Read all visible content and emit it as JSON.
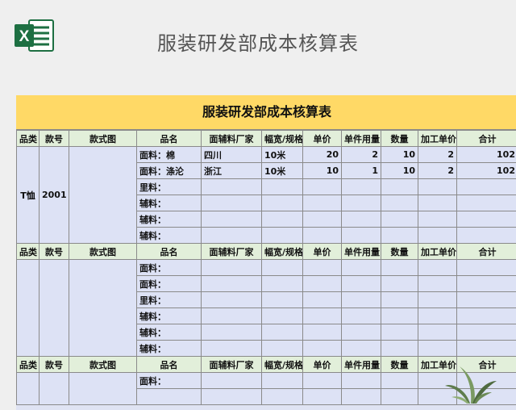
{
  "header": {
    "page_title": "服装研发部成本核算表",
    "logo_letter": "X"
  },
  "sheet": {
    "title": "服装研发部成本核算表",
    "columns": [
      "品类",
      "款号",
      "款式图",
      "品名",
      "面辅料厂家",
      "幅宽/规格",
      "单价",
      "单件用量",
      "数量",
      "加工单价",
      "合计"
    ],
    "blocks": [
      {
        "category": "T恤",
        "style_no": "2001",
        "rows": [
          {
            "name": "面料：棉",
            "vendor": "四川",
            "spec": "10米",
            "unit_price": "20",
            "usage": "2",
            "qty": "10",
            "proc_price": "2",
            "total": "102"
          },
          {
            "name": "面料：涤沦",
            "vendor": "浙江",
            "spec": "10米",
            "unit_price": "10",
            "usage": "1",
            "qty": "10",
            "proc_price": "2",
            "total": "102"
          },
          {
            "name": "里料：",
            "vendor": "",
            "spec": "",
            "unit_price": "",
            "usage": "",
            "qty": "",
            "proc_price": "",
            "total": ""
          },
          {
            "name": "辅料：",
            "vendor": "",
            "spec": "",
            "unit_price": "",
            "usage": "",
            "qty": "",
            "proc_price": "",
            "total": ""
          },
          {
            "name": "辅料：",
            "vendor": "",
            "spec": "",
            "unit_price": "",
            "usage": "",
            "qty": "",
            "proc_price": "",
            "total": ""
          },
          {
            "name": "辅料：",
            "vendor": "",
            "spec": "",
            "unit_price": "",
            "usage": "",
            "qty": "",
            "proc_price": "",
            "total": ""
          }
        ]
      },
      {
        "category": "",
        "style_no": "",
        "rows": [
          {
            "name": "面料：",
            "vendor": "",
            "spec": "",
            "unit_price": "",
            "usage": "",
            "qty": "",
            "proc_price": "",
            "total": ""
          },
          {
            "name": "面料：",
            "vendor": "",
            "spec": "",
            "unit_price": "",
            "usage": "",
            "qty": "",
            "proc_price": "",
            "total": ""
          },
          {
            "name": "里料：",
            "vendor": "",
            "spec": "",
            "unit_price": "",
            "usage": "",
            "qty": "",
            "proc_price": "",
            "total": ""
          },
          {
            "name": "辅料：",
            "vendor": "",
            "spec": "",
            "unit_price": "",
            "usage": "",
            "qty": "",
            "proc_price": "",
            "total": ""
          },
          {
            "name": "辅料：",
            "vendor": "",
            "spec": "",
            "unit_price": "",
            "usage": "",
            "qty": "",
            "proc_price": "",
            "total": ""
          },
          {
            "name": "辅料：",
            "vendor": "",
            "spec": "",
            "unit_price": "",
            "usage": "",
            "qty": "",
            "proc_price": "",
            "total": ""
          }
        ]
      },
      {
        "category": "",
        "style_no": "",
        "rows": [
          {
            "name": "面料：",
            "vendor": "",
            "spec": "",
            "unit_price": "",
            "usage": "",
            "qty": "",
            "proc_price": "",
            "total": ""
          },
          {
            "name": "",
            "vendor": "",
            "spec": "",
            "unit_price": "",
            "usage": "",
            "qty": "",
            "proc_price": "",
            "total": ""
          }
        ]
      }
    ]
  },
  "colors": {
    "title_band": "#ffd966",
    "header_row": "#e2efda",
    "data_row": "#dde2f5",
    "excel_green": "#1d6f42"
  }
}
